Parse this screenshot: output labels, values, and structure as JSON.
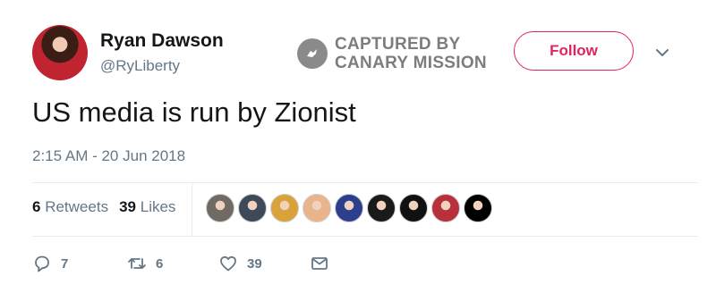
{
  "user": {
    "name": "Ryan Dawson",
    "handle": "@RyLiberty"
  },
  "watermark": {
    "line1": "CAPTURED BY",
    "line2": "CANARY MISSION"
  },
  "follow_label": "Follow",
  "tweet": {
    "text": "US media is run by Zionist",
    "timestamp": "2:15 AM - 20 Jun 2018"
  },
  "stats": {
    "retweets_count": "6",
    "retweets_label": "Retweets",
    "likes_count": "39",
    "likes_label": "Likes"
  },
  "likers": [
    {
      "color": "#6f6a62"
    },
    {
      "color": "#3e4a5a"
    },
    {
      "color": "#d9a23a"
    },
    {
      "color": "#e8b48c"
    },
    {
      "color": "#2c3f8f"
    },
    {
      "color": "#1a1a1a"
    },
    {
      "color": "#111111"
    },
    {
      "color": "#b8303a"
    },
    {
      "color": "#000000"
    }
  ],
  "actions": {
    "reply_count": "7",
    "retweet_count": "6",
    "like_count": "39"
  },
  "colors": {
    "accent": "#e0245e",
    "muted": "#657786",
    "text": "#14171a"
  }
}
